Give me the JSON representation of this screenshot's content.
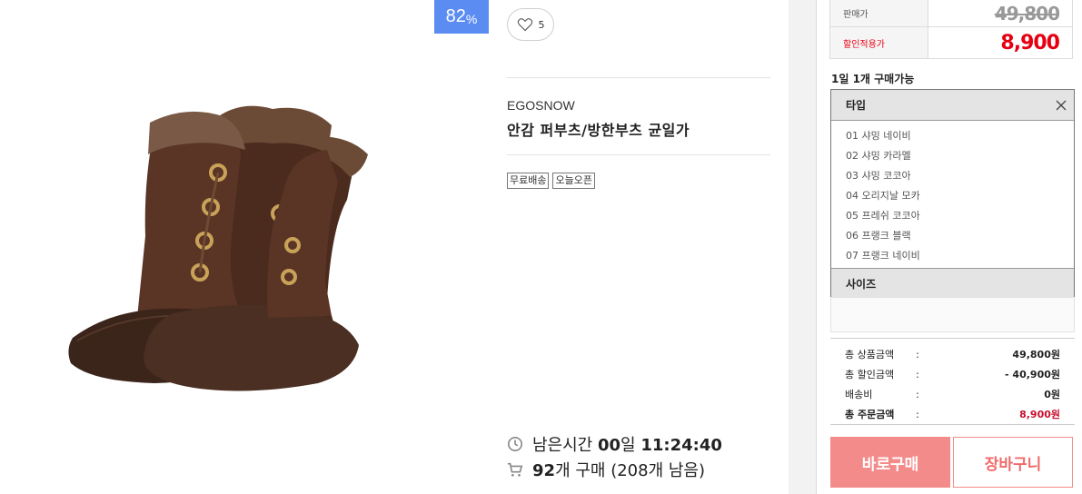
{
  "product": {
    "discount_number": "82",
    "discount_unit": "%",
    "likes": "5",
    "brand": "EGOSNOW",
    "title": "안감 퍼부츠/방한부츠 균일가",
    "tags": [
      "무료배송",
      "오늘오픈"
    ],
    "timer": {
      "label": "남은시간",
      "days": "00",
      "days_unit": "일",
      "time": "11:24:40"
    },
    "sold": {
      "count": "92",
      "unit": "개 구매",
      "remaining": "(208개 남음)"
    }
  },
  "order": {
    "price_label": "판매가",
    "original_price": "49,800",
    "sale_label": "할인적용가",
    "sale_price": "8,900",
    "limit_text": "1일 1개 구매가능",
    "option_header": "타입",
    "options": [
      "01 샤밍 네이비",
      "02 샤밍 카라멜",
      "03 샤밍 코코아",
      "04 오리지날 모카",
      "05 프레쉬 코코아",
      "06 프랭크 블랙",
      "07 프랭크 네이비"
    ],
    "size_header": "사이즈",
    "summary": [
      {
        "label": "총 상품금액",
        "colon": ":",
        "value": "49,800원"
      },
      {
        "label": "총 할인금액",
        "colon": ":",
        "value": "- 40,900원"
      },
      {
        "label": "배송비",
        "colon": ":",
        "value": "0원"
      },
      {
        "label": "총 주문금액",
        "colon": ":",
        "value": "8,900원"
      }
    ],
    "buy_now_label": "바로구매",
    "cart_label": "장바구니"
  },
  "colors": {
    "badge": "#5b8cf2",
    "sale_red": "#e60012",
    "buy_button": "#f48b8b"
  },
  "icons": [
    "heart-icon",
    "clock-icon",
    "cart-icon",
    "close-icon"
  ]
}
